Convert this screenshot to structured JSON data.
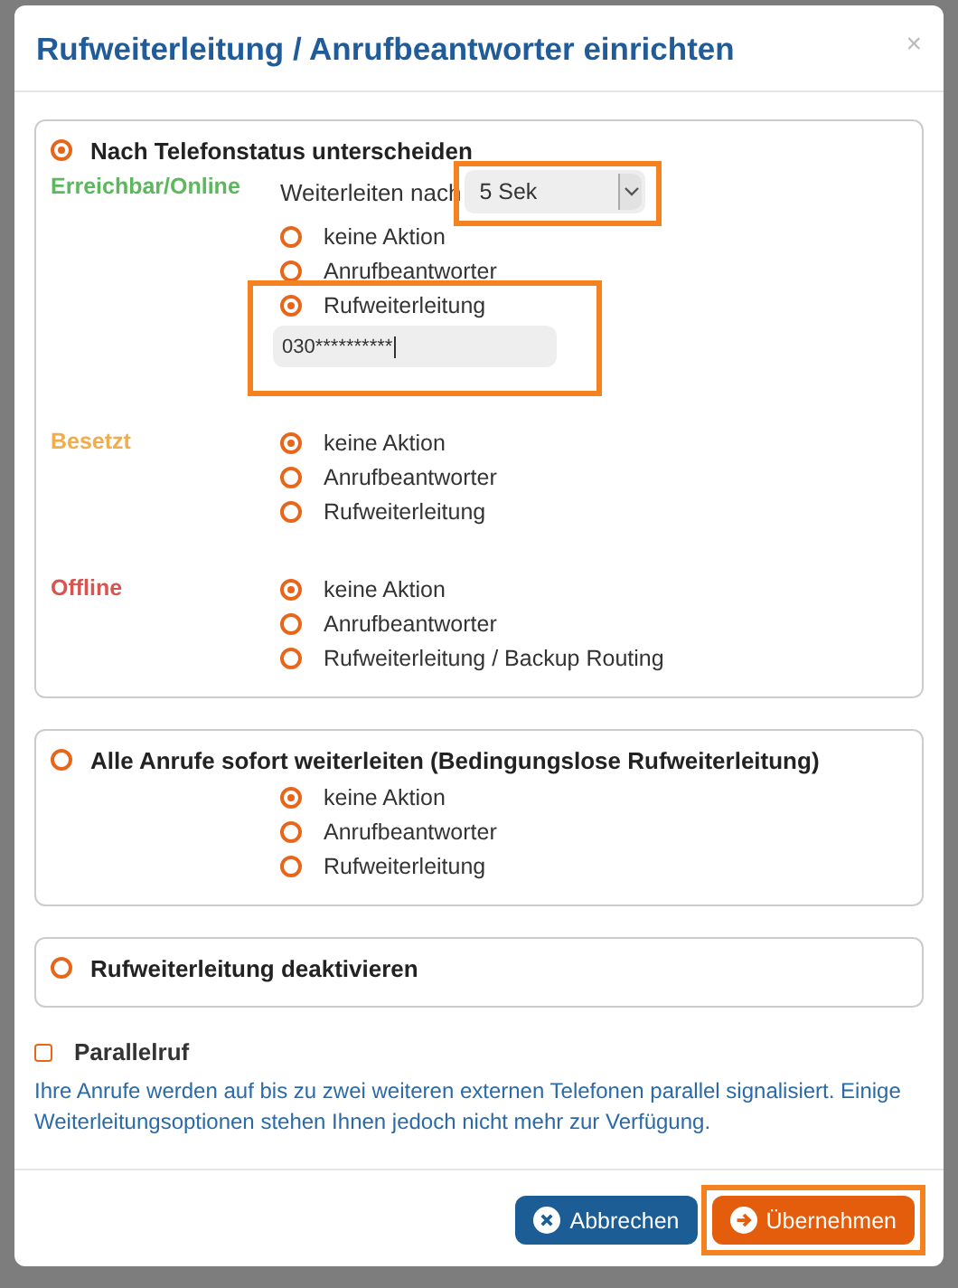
{
  "dialog": {
    "title": "Rufweiterleitung / Anrufbeantworter einrichten",
    "close": "×"
  },
  "sections": [
    {
      "label": "Nach Telefonstatus unterscheiden",
      "selected": true,
      "groups": [
        {
          "status": "Erreichbar/Online",
          "color": "#5cb85c",
          "delay": {
            "label": "Weiterleiten nach",
            "value": "5 Sek",
            "highlighted": true
          },
          "options": [
            {
              "label": "keine Aktion",
              "selected": false
            },
            {
              "label": "Anrufbeantworter",
              "selected": false
            },
            {
              "label": "Rufweiterleitung",
              "selected": true,
              "highlighted": true,
              "input": "030**********"
            }
          ]
        },
        {
          "status": "Besetzt",
          "color": "#f0ad4e",
          "options": [
            {
              "label": "keine Aktion",
              "selected": true
            },
            {
              "label": "Anrufbeantworter",
              "selected": false
            },
            {
              "label": "Rufweiterleitung",
              "selected": false
            }
          ]
        },
        {
          "status": "Offline",
          "color": "#d9534f",
          "options": [
            {
              "label": "keine Aktion",
              "selected": true
            },
            {
              "label": "Anrufbeantworter",
              "selected": false
            },
            {
              "label": "Rufweiterleitung / Backup Routing",
              "selected": false
            }
          ]
        }
      ]
    },
    {
      "label": "Alle Anrufe sofort weiterleiten (Bedingungslose Rufweiterleitung)",
      "selected": false,
      "groups": [
        {
          "options": [
            {
              "label": "keine Aktion",
              "selected": true
            },
            {
              "label": "Anrufbeantworter",
              "selected": false
            },
            {
              "label": "Rufweiterleitung",
              "selected": false
            }
          ]
        }
      ]
    },
    {
      "label": "Rufweiterleitung deaktivieren",
      "selected": false
    }
  ],
  "parallel": {
    "label": "Parallelruf",
    "checked": false,
    "description": "Ihre Anrufe werden auf bis zu zwei weiteren externen Telefonen parallel signalisiert. Einige Weiterleitungsoptionen stehen Ihnen jedoch nicht mehr zur Verfügung."
  },
  "buttons": [
    {
      "label": "Abbrechen",
      "kind": "cancel"
    },
    {
      "label": "Übernehmen",
      "kind": "apply",
      "highlighted": true
    }
  ]
}
